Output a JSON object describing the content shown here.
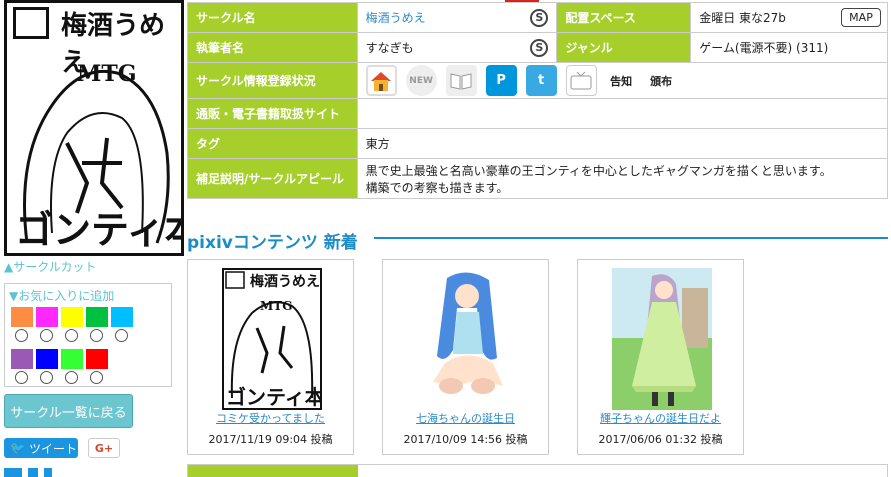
{
  "cut": {
    "author_glyph": "梅酒うめえ",
    "link": "▲サークルカット"
  },
  "favorites": {
    "title": "▼お気に入りに追加",
    "colors_row1": [
      "#ff8c44",
      "#ff28ff",
      "#ffff00",
      "#00c040",
      "#00bfff"
    ],
    "colors_row2": [
      "#9b59b6",
      "#0000ff",
      "#33ff33",
      "#ff0000"
    ]
  },
  "buttons": {
    "back": "サークル一覧に戻る",
    "tweet": "ツイート",
    "gplus": "G+"
  },
  "info": {
    "circle_label": "サークル名",
    "circle_value": "梅酒うめえ",
    "space_label": "配置スペース",
    "space_value": "金曜日 東な27b",
    "map": "MAP",
    "author_label": "執筆者名",
    "author_value": "すなぎも",
    "genre_label": "ジャンル",
    "genre_value": "ゲーム(電源不要) (311)",
    "status_label": "サークル情報登録状況",
    "status_icons": [
      "home-icon",
      "new-icon",
      "book-icon",
      "pixiv-icon",
      "tumblr-icon",
      "niconico-icon",
      "announce-icon",
      "distribution-icon"
    ],
    "status_icon_text": [
      "",
      "NEW",
      "",
      "P",
      "t",
      "",
      "告知",
      "頒布"
    ],
    "shop_label": "通販・電子書籍取扱サイト",
    "shop_value": "",
    "tag_label": "タグ",
    "tag_value": "東方",
    "appeal_label": "補足説明/サークルアピール",
    "appeal_line1": "黒で史上最強と名高い豪華の王ゴンティを中心としたギャグマンガを描くと思います。",
    "appeal_line2": "構築での考察も描きます。"
  },
  "pixiv": {
    "heading": "pixivコンテンツ 新着",
    "items": [
      {
        "caption": "コミケ受かってました",
        "date": "2017/11/19 09:04 投稿"
      },
      {
        "caption": "七海ちゃんの誕生日",
        "date": "2017/10/09 14:56 投稿"
      },
      {
        "caption": "輝子ちゃんの誕生日だよ",
        "date": "2017/06/06 01:32 投稿"
      }
    ]
  }
}
